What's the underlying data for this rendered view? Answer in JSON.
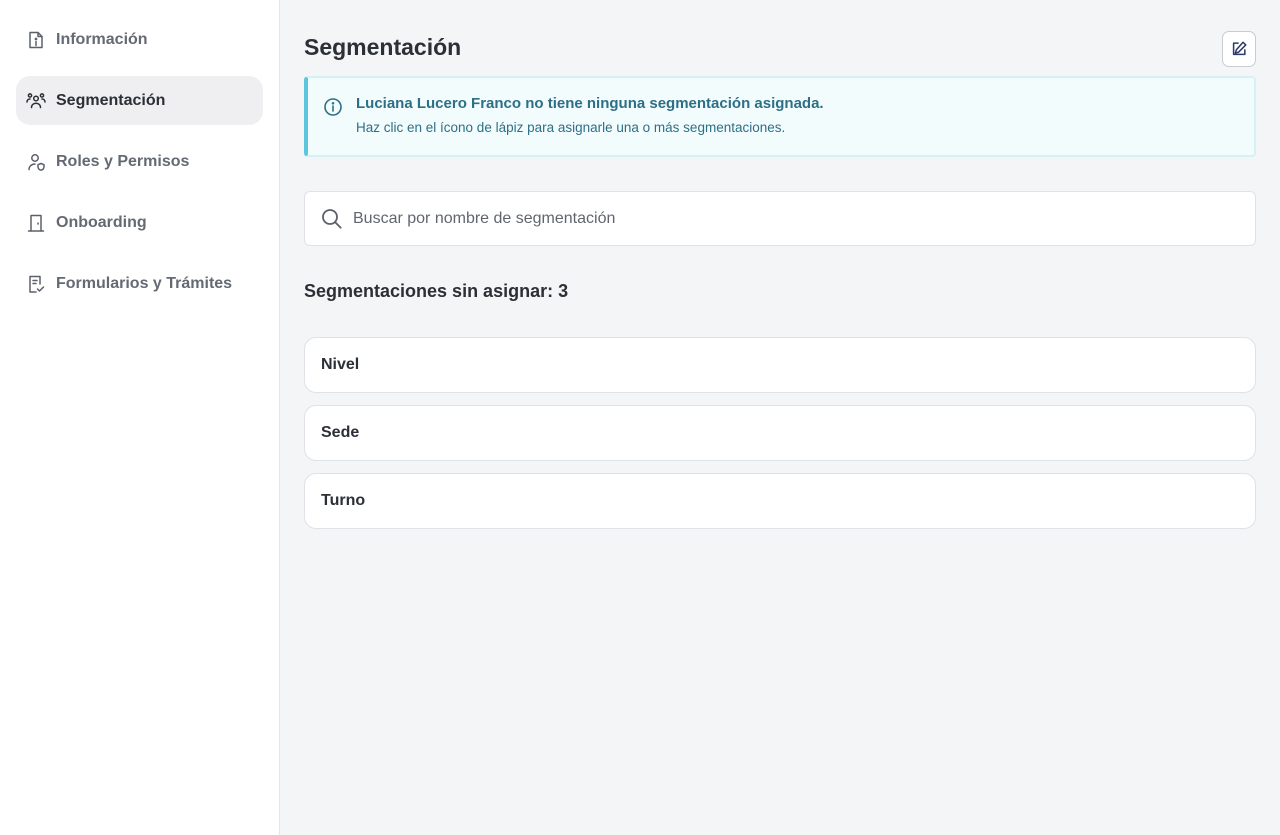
{
  "sidebar": {
    "items": [
      {
        "label": "Información",
        "icon": "document-info-icon",
        "active": false
      },
      {
        "label": "Segmentación",
        "icon": "users-group-icon",
        "active": true
      },
      {
        "label": "Roles y Permisos",
        "icon": "user-shield-icon",
        "active": false
      },
      {
        "label": "Onboarding",
        "icon": "door-icon",
        "active": false
      },
      {
        "label": "Formularios y Trámites",
        "icon": "clipboard-check-icon",
        "active": false
      }
    ]
  },
  "main": {
    "title": "Segmentación",
    "edit_icon": "pencil-square-icon",
    "alert": {
      "title": "Luciana Lucero Franco no tiene ninguna segmentación asignada.",
      "text": "Haz clic en el ícono de lápiz para asignarle una o más segmentaciones.",
      "icon": "info-circle-icon"
    },
    "search": {
      "placeholder": "Buscar por nombre de segmentación",
      "value": ""
    },
    "section_title": "Segmentaciones sin asignar: 3",
    "segments": [
      {
        "label": "Nivel"
      },
      {
        "label": "Sede"
      },
      {
        "label": "Turno"
      }
    ]
  },
  "colors": {
    "accent_info": "#5bc6dc",
    "info_text": "#2d6f86",
    "active_bg": "#efeff1",
    "page_bg": "#f4f5f7"
  }
}
